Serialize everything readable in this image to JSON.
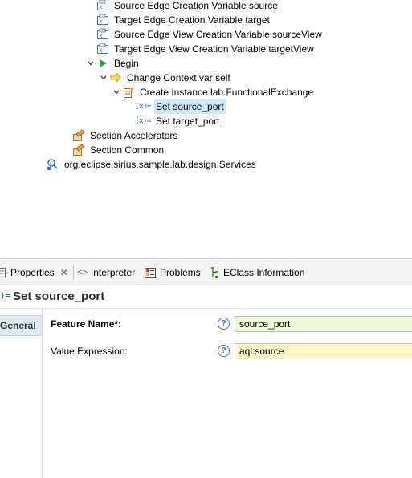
{
  "tree": {
    "items": [
      {
        "label": "Source Edge Creation Variable source"
      },
      {
        "label": "Target Edge Creation Variable target"
      },
      {
        "label": "Source Edge View Creation Variable sourceView"
      },
      {
        "label": "Target Edge View Creation Variable targetView"
      },
      {
        "label": "Begin"
      },
      {
        "label": "Change Context var:self"
      },
      {
        "label": "Create Instance lab.FunctionalExchange"
      },
      {
        "label": "Set source_port",
        "var_glyph": "(x)="
      },
      {
        "label": "Set target_port",
        "var_glyph": "(x)="
      },
      {
        "label": "Section Accelerators"
      },
      {
        "label": "Section Common"
      },
      {
        "label": "org.eclipse.sirius.sample.lab.design.Services"
      }
    ],
    "selected_index": 7
  },
  "properties": {
    "tabs": [
      {
        "label": "Properties",
        "close": "✕"
      },
      {
        "label": "Interpreter",
        "glyph": "<>"
      },
      {
        "label": "Problems"
      },
      {
        "label": "EClass Information"
      }
    ],
    "title_glyph": ")=",
    "title": "Set source_port",
    "side_tab": "General",
    "fields": [
      {
        "label": "Feature Name*:",
        "value": "source_port",
        "help": "?"
      },
      {
        "label": "Value Expression:",
        "value": "aql:source",
        "help": "?"
      }
    ]
  },
  "colors": {
    "selection": "#cce8ff",
    "feature_field_bg": "#eef7d6",
    "expression_field_bg": "#fff6c8",
    "help_blue": "#3c6eb4",
    "begin_green": "#2e9b3a"
  }
}
